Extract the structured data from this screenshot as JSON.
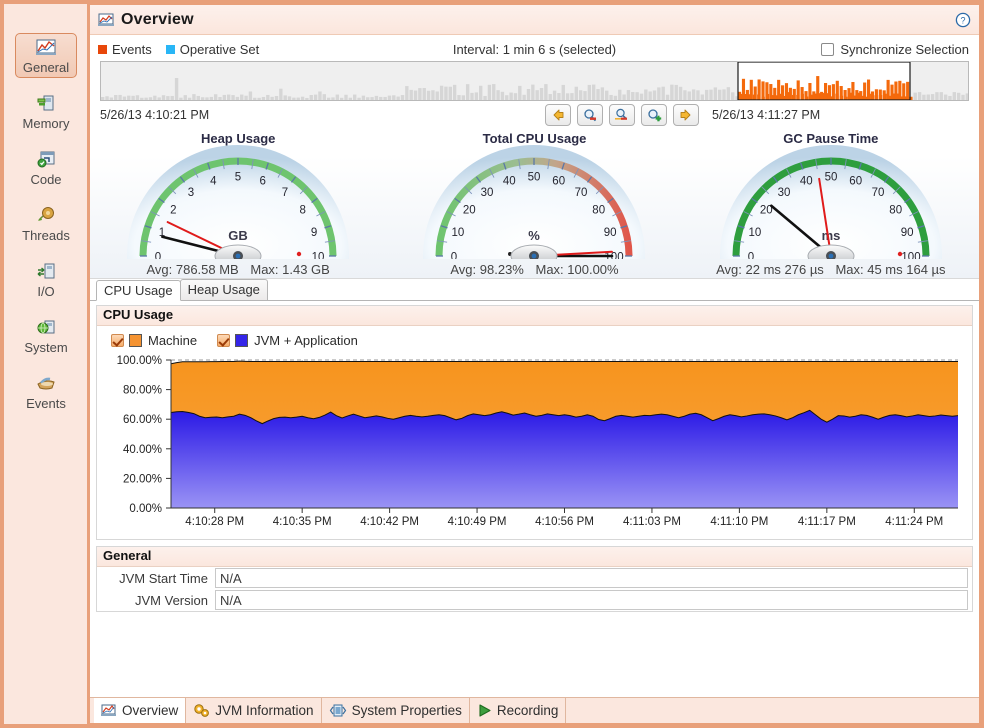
{
  "window": {
    "title": "Overview",
    "title_icon": "chart-page-icon",
    "help_icon": "help-icon"
  },
  "sidebar": {
    "items": [
      {
        "label": "General",
        "icon": "general-chart-icon",
        "selected": true
      },
      {
        "label": "Memory",
        "icon": "memory-chip-icon",
        "selected": false
      },
      {
        "label": "Code",
        "icon": "code-window-icon",
        "selected": false
      },
      {
        "label": "Threads",
        "icon": "threads-coil-icon",
        "selected": false
      },
      {
        "label": "I/O",
        "icon": "io-transfer-icon",
        "selected": false
      },
      {
        "label": "System",
        "icon": "system-globe-icon",
        "selected": false
      },
      {
        "label": "Events",
        "icon": "events-basket-icon",
        "selected": false
      }
    ]
  },
  "legend": {
    "events_label": "Events",
    "events_color": "#e8470a",
    "operative_set_label": "Operative Set",
    "operative_set_color": "#29b6f6",
    "interval_text": "Interval: 1 min 6 s (selected)",
    "sync_label": "Synchronize Selection",
    "sync_checked": false
  },
  "timeline": {
    "start_time": "5/26/13 4:10:21 PM",
    "end_time": "5/26/13 4:11:27 PM",
    "selection_color": "#f4690b",
    "bar_color": "#d6d6d6",
    "buttons": [
      {
        "name": "pan-left-button",
        "icon": "arrow-left-icon"
      },
      {
        "name": "zoom-out-button",
        "icon": "magnifier-minus-icon"
      },
      {
        "name": "zoom-fit-button",
        "icon": "magnifier-range-icon"
      },
      {
        "name": "zoom-in-button",
        "icon": "magnifier-plus-icon"
      },
      {
        "name": "pan-right-button",
        "icon": "arrow-right-icon"
      }
    ]
  },
  "gauges": [
    {
      "title": "Heap Usage",
      "unit": "GB",
      "min": 0,
      "max": 10,
      "ticks": [
        0,
        1,
        2,
        3,
        4,
        5,
        6,
        7,
        8,
        9,
        10
      ],
      "arc_colors": [
        "#6ec46e"
      ],
      "needle_red_value": 1.43,
      "needle_black_value": 0.79,
      "avg_label": "Avg: 786.58 MB",
      "max_label": "Max: 1.43 GB"
    },
    {
      "title": "Total CPU Usage",
      "unit": "%",
      "min": 0,
      "max": 100,
      "ticks": [
        0,
        10,
        20,
        30,
        40,
        50,
        60,
        70,
        80,
        90,
        100
      ],
      "arc_colors": [
        "#6ec46e",
        "#c8a48c",
        "#e05b4a"
      ],
      "needle_red_value": 98.23,
      "needle_black_value": 100.0,
      "avg_label": "Avg: 98.23%",
      "max_label": "Max: 100.00%"
    },
    {
      "title": "GC Pause Time",
      "unit": "ms",
      "min": 0,
      "max": 100,
      "ticks": [
        0,
        10,
        20,
        30,
        40,
        50,
        60,
        70,
        80,
        90,
        100
      ],
      "arc_colors": [
        "#2e9e3e"
      ],
      "needle_red_value": 45.16,
      "needle_black_value": 22.28,
      "avg_label": "Avg: 22 ms 276 µs",
      "max_label": "Max: 45 ms 164 µs"
    }
  ],
  "tabs": {
    "items": [
      {
        "label": "CPU Usage",
        "active": true
      },
      {
        "label": "Heap Usage",
        "active": false
      }
    ]
  },
  "chart_panel": {
    "header": "CPU Usage",
    "series_toggles": [
      {
        "label": "Machine",
        "color": "#f59331",
        "checked": true
      },
      {
        "label": "JVM + Application",
        "color": "#3425e8",
        "checked": true
      }
    ]
  },
  "chart_data": {
    "type": "area",
    "title": "CPU Usage",
    "xlabel": "",
    "ylabel": "",
    "stacked": true,
    "grid": true,
    "legend_position": "top",
    "ylim": [
      0,
      100
    ],
    "yticks": [
      0,
      20,
      40,
      60,
      80,
      100
    ],
    "ytick_labels": [
      "0.00%",
      "20.00%",
      "40.00%",
      "60.00%",
      "80.00%",
      "100.00%"
    ],
    "xtick_labels": [
      "4:10:28 PM",
      "4:10:35 PM",
      "4:10:42 PM",
      "4:10:49 PM",
      "4:10:56 PM",
      "4:11:03 PM",
      "4:11:10 PM",
      "4:11:17 PM",
      "4:11:24 PM"
    ],
    "series": [
      {
        "name": "JVM + Application",
        "color": "#3425e8",
        "values": [
          64.5,
          65.0,
          65.2,
          64.6,
          63.8,
          62.0,
          61.0,
          61.3,
          61.5,
          61.0,
          61.6,
          62.0,
          63.4,
          62.6,
          61.0,
          58.8,
          57.0,
          58.8,
          60.4,
          61.2,
          61.4,
          61.0,
          61.4,
          62.0,
          61.0,
          60.3,
          61.2,
          62.8,
          64.8,
          62.4,
          60.8,
          62.2,
          63.4,
          62.2,
          61.0,
          61.6,
          62.2,
          61.6,
          60.6,
          60.0,
          61.0,
          62.0,
          62.6,
          62.0,
          61.6,
          62.0,
          62.6,
          63.0,
          62.4,
          61.0,
          59.6,
          60.6,
          62.4,
          63.6,
          63.0,
          62.4,
          63.0,
          64.2,
          65.0,
          64.0,
          62.8,
          63.4,
          64.2,
          63.0,
          62.0,
          62.6,
          63.6,
          63.0,
          62.4,
          63.0,
          62.4,
          61.4,
          62.0,
          63.0,
          62.0,
          59.8,
          59.0,
          60.4,
          62.0,
          62.6,
          62.0,
          61.4,
          62.0,
          62.6,
          62.4,
          63.0,
          63.4,
          63.0,
          62.0,
          61.0,
          62.0,
          63.4,
          64.0,
          63.0,
          61.0,
          59.0,
          60.4,
          62.0,
          63.0,
          62.4,
          61.6,
          62.2,
          63.0,
          63.4,
          63.6,
          63.0,
          62.2,
          61.0,
          59.6,
          61.0,
          63.0,
          64.4,
          66.0,
          63.0,
          60.0,
          58.0,
          60.0,
          62.4,
          62.2,
          61.4,
          62.0,
          63.0,
          62.6,
          61.4,
          60.0,
          61.4,
          62.6,
          63.0,
          62.4,
          61.6,
          62.2,
          63.0,
          62.4,
          61.8,
          62.2,
          62.8,
          62.4,
          62.0,
          62.4
        ],
        "avg": 62.1
      },
      {
        "name": "Machine",
        "color": "#f59331",
        "values": [
          33.0,
          33.2,
          33.6,
          34.2,
          35.0,
          36.8,
          37.8,
          37.6,
          37.4,
          38.0,
          37.4,
          37.0,
          35.8,
          36.5,
          38.0,
          40.2,
          42.0,
          40.2,
          38.6,
          37.8,
          37.6,
          38.0,
          37.6,
          37.0,
          38.0,
          38.7,
          37.8,
          36.2,
          34.2,
          36.6,
          38.2,
          36.8,
          35.6,
          36.8,
          38.0,
          37.4,
          36.8,
          37.4,
          38.4,
          39.0,
          38.0,
          37.0,
          36.4,
          37.0,
          37.4,
          37.0,
          36.4,
          36.0,
          36.6,
          38.0,
          39.4,
          38.4,
          36.6,
          35.4,
          36.0,
          36.6,
          36.0,
          34.8,
          34.0,
          35.0,
          36.2,
          35.6,
          34.8,
          36.0,
          37.0,
          36.4,
          35.4,
          36.0,
          36.6,
          36.0,
          36.6,
          37.6,
          37.0,
          36.0,
          37.0,
          39.2,
          40.0,
          38.6,
          37.0,
          36.4,
          37.0,
          37.6,
          37.0,
          36.4,
          36.6,
          36.0,
          35.6,
          36.0,
          37.0,
          38.0,
          37.0,
          35.6,
          35.0,
          36.0,
          38.0,
          40.0,
          38.6,
          37.0,
          36.0,
          36.6,
          37.4,
          36.8,
          36.0,
          35.6,
          35.4,
          36.0,
          36.8,
          38.0,
          39.4,
          38.0,
          36.0,
          34.6,
          33.0,
          36.0,
          39.0,
          41.0,
          39.0,
          36.6,
          36.8,
          37.6,
          37.0,
          36.0,
          36.4,
          37.6,
          39.0,
          37.6,
          36.4,
          36.0,
          36.6,
          37.4,
          36.8,
          36.0,
          36.6,
          37.2,
          36.8,
          36.2,
          36.6,
          37.0,
          36.6
        ],
        "avg": 37.0
      }
    ]
  },
  "general_panel": {
    "header": "General",
    "rows": [
      {
        "key": "JVM Start Time",
        "value": "N/A"
      },
      {
        "key": "JVM Version",
        "value": "N/A"
      }
    ]
  },
  "footer": {
    "tabs": [
      {
        "label": "Overview",
        "icon": "overview-chart-icon",
        "active": true
      },
      {
        "label": "JVM Information",
        "icon": "gears-icon",
        "active": false
      },
      {
        "label": "System Properties",
        "icon": "properties-icon",
        "active": false
      },
      {
        "label": "Recording",
        "icon": "play-triangle-icon",
        "active": false
      }
    ]
  }
}
